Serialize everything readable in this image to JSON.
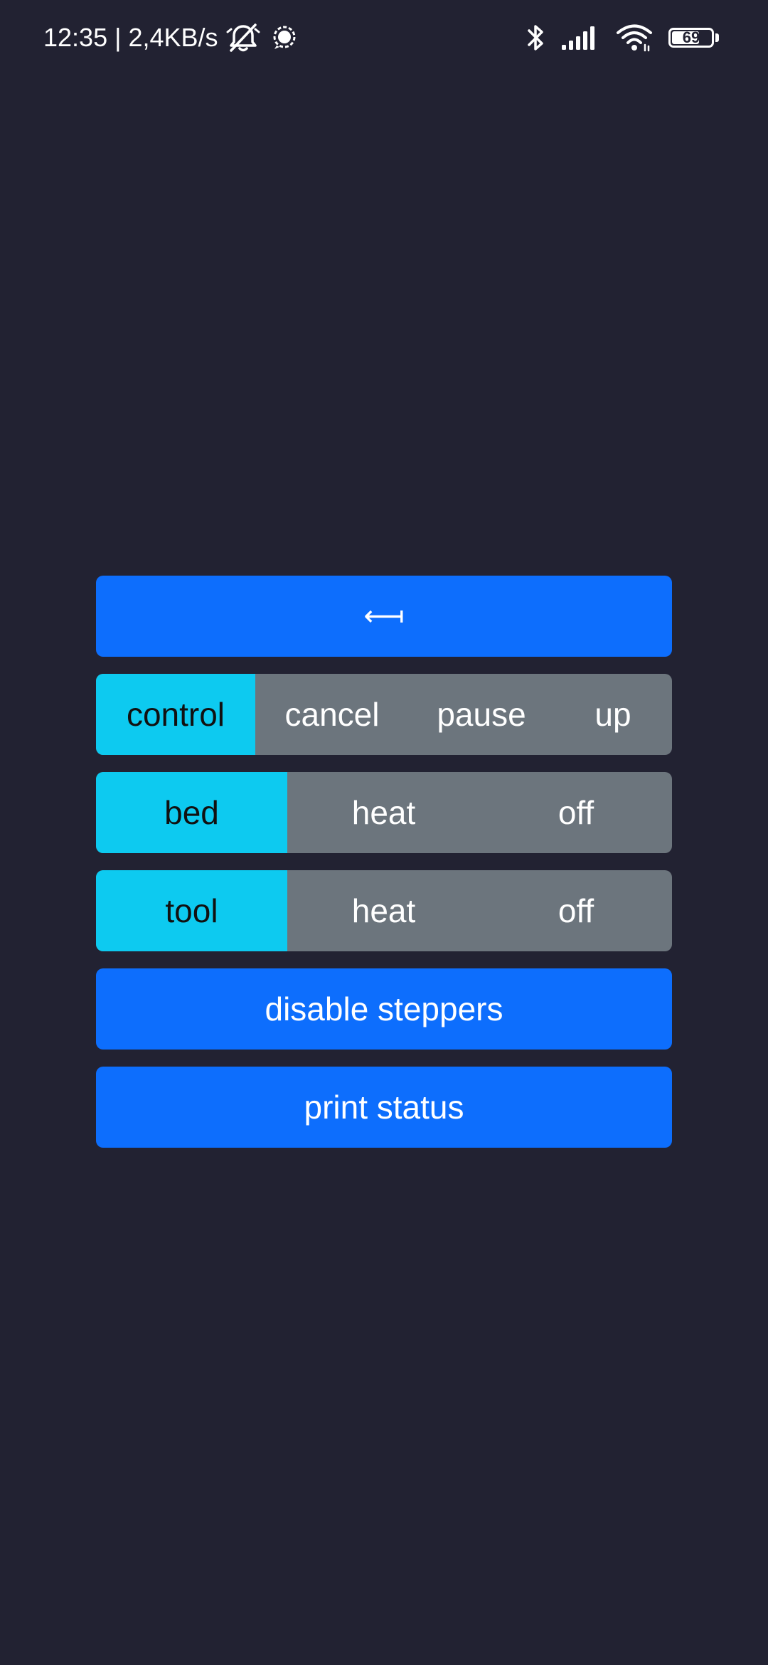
{
  "status_bar": {
    "time_speed": "12:35 | 2,4KB/s",
    "battery_level": "69",
    "icons": [
      "notifications-off-icon",
      "chat-bubble-icon",
      "bluetooth-icon",
      "signal-icon",
      "wifi-icon",
      "battery-icon"
    ]
  },
  "panel": {
    "back_arrow": "⟻",
    "control_row": {
      "head": "control",
      "items": [
        "cancel",
        "pause",
        "up"
      ]
    },
    "bed_row": {
      "head": "bed",
      "items": [
        "heat",
        "off"
      ]
    },
    "tool_row": {
      "head": "tool",
      "items": [
        "heat",
        "off"
      ]
    },
    "disable_steppers": "disable steppers",
    "print_status": "print status"
  },
  "colors": {
    "background": "#222232",
    "primary": "#0d6efd",
    "secondary": "#6c757d",
    "info": "#0dcaf0",
    "text_light": "#ffffff",
    "text_dark": "#111111"
  }
}
